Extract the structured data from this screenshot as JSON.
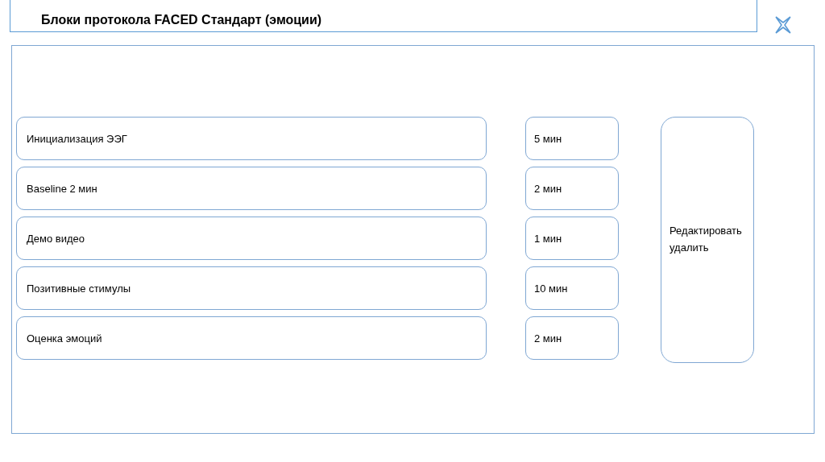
{
  "header": {
    "title": "Блоки протокола FACED Стандарт (эмоции)"
  },
  "blocks": [
    {
      "name": "Инициализация ЭЭГ",
      "duration": "5 мин"
    },
    {
      "name": "Baseline 2 мин",
      "duration": "2 мин"
    },
    {
      "name": "Демо видео",
      "duration": "1 мин"
    },
    {
      "name": "Позитивные стимулы",
      "duration": "10 мин"
    },
    {
      "name": "Оценка эмоций",
      "duration": "2 мин"
    }
  ],
  "action": {
    "label": "Редактировать удалить"
  }
}
